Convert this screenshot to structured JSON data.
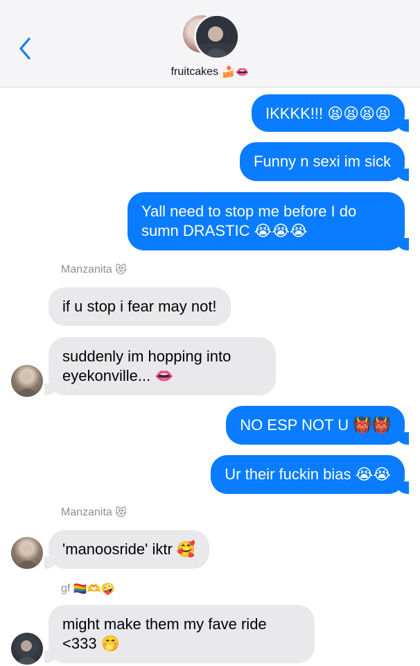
{
  "header": {
    "back_icon": "chevron-left-icon",
    "group_name": "fruitcakes",
    "group_emoji": "🍰👄"
  },
  "messages": [
    {
      "dir": "out",
      "text": "IKKKK!!!",
      "emoji": "😫😫😫😫"
    },
    {
      "dir": "out",
      "text": "Funny n sexi im sick",
      "emoji": ""
    },
    {
      "dir": "out",
      "text": "Yall need to stop me before I do sumn DRASTIC",
      "emoji": "😭😭😭"
    },
    {
      "dir": "in",
      "sender": "Manzanita",
      "sender_emoji": "😻",
      "text": "if u stop i fear may not!",
      "emoji": ""
    },
    {
      "dir": "in",
      "text": "suddenly im hopping into eyekonville...",
      "emoji": "👄"
    },
    {
      "dir": "out",
      "text": "NO ESP NOT U",
      "emoji": "👹👹"
    },
    {
      "dir": "out",
      "text": "Ur their fuckin bias",
      "emoji": "😭😭"
    },
    {
      "dir": "in",
      "sender": "Manzanita",
      "sender_emoji": "😻",
      "text": "'manoosride' iktr",
      "emoji": "🥰"
    },
    {
      "dir": "in",
      "sender": "gf",
      "sender_emoji": "🏳️‍🌈🫶🤪",
      "text": "might make them my fave ride <333",
      "emoji": "🤭"
    }
  ],
  "colors": {
    "outgoing_bubble": "#0a7cff",
    "incoming_bubble": "#e9e9eb",
    "header_bg": "#f5f5f7",
    "sender_text": "#8e8e93"
  }
}
